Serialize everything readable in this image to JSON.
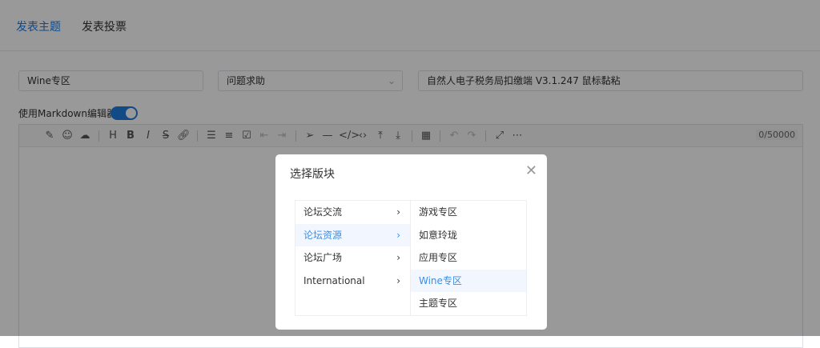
{
  "tabs": [
    "发表主题",
    "发表投票"
  ],
  "form": {
    "board": "Wine专区",
    "category": "问题求助",
    "title": "自然人电子税务局扣缴端 V3.1.247 鼠标黏粘",
    "markdown_label": "使用Markdown编辑器",
    "char_count": "0/50000"
  },
  "toolbar_icons": [
    "edit-icon",
    "emoji-icon",
    "upload-icon",
    "heading-icon",
    "bold-icon",
    "italic-icon",
    "strikethrough-icon",
    "link-icon",
    "unordered-list-icon",
    "ordered-list-icon",
    "checklist-icon",
    "outdent-icon",
    "indent-icon",
    "send-icon",
    "hr-icon",
    "code-block-icon",
    "inline-code-icon",
    "top-icon",
    "bottom-icon",
    "table-icon",
    "undo-icon",
    "redo-icon",
    "fullscreen-icon",
    "more-icon"
  ],
  "modal": {
    "title": "选择版块",
    "level1": [
      "论坛交流",
      "论坛资源",
      "论坛广场",
      "International"
    ],
    "level2": [
      "游戏专区",
      "如意玲珑",
      "应用专区",
      "Wine专区",
      "主题专区"
    ],
    "selected1": 1,
    "selected2": 3
  }
}
